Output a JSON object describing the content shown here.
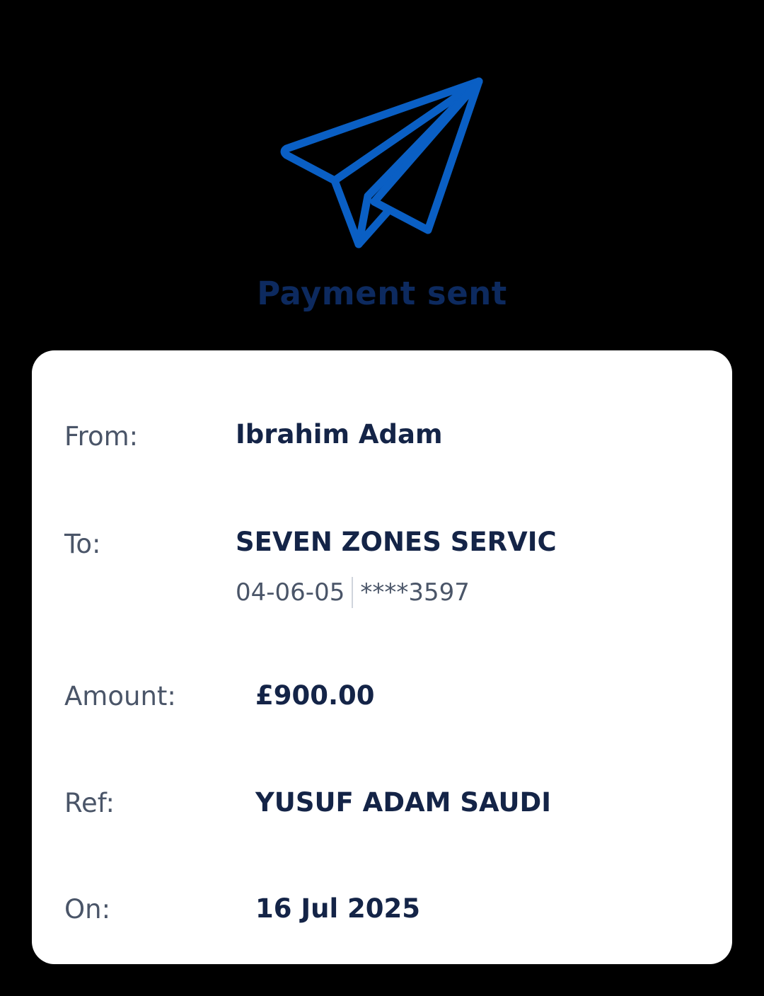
{
  "header": {
    "icon": "paper-plane-icon",
    "title": "Payment sent"
  },
  "details": {
    "from": {
      "label": "From:",
      "value": "Ibrahim Adam"
    },
    "to": {
      "label": "To:",
      "value": "SEVEN ZONES SERVIC",
      "sort_code": "04-06-05",
      "account": "****3597"
    },
    "amount": {
      "label": "Amount:",
      "value": "£900.00"
    },
    "ref": {
      "label": "Ref:",
      "value": "YUSUF ADAM SAUDI"
    },
    "on": {
      "label": "On:",
      "value": "16 Jul 2025"
    }
  },
  "colors": {
    "background": "#000000",
    "icon_blue": "#0a5fc4",
    "title_navy": "#0d2a5f",
    "value_navy": "#142447",
    "label_gray": "#4a5568",
    "card": "#ffffff"
  }
}
